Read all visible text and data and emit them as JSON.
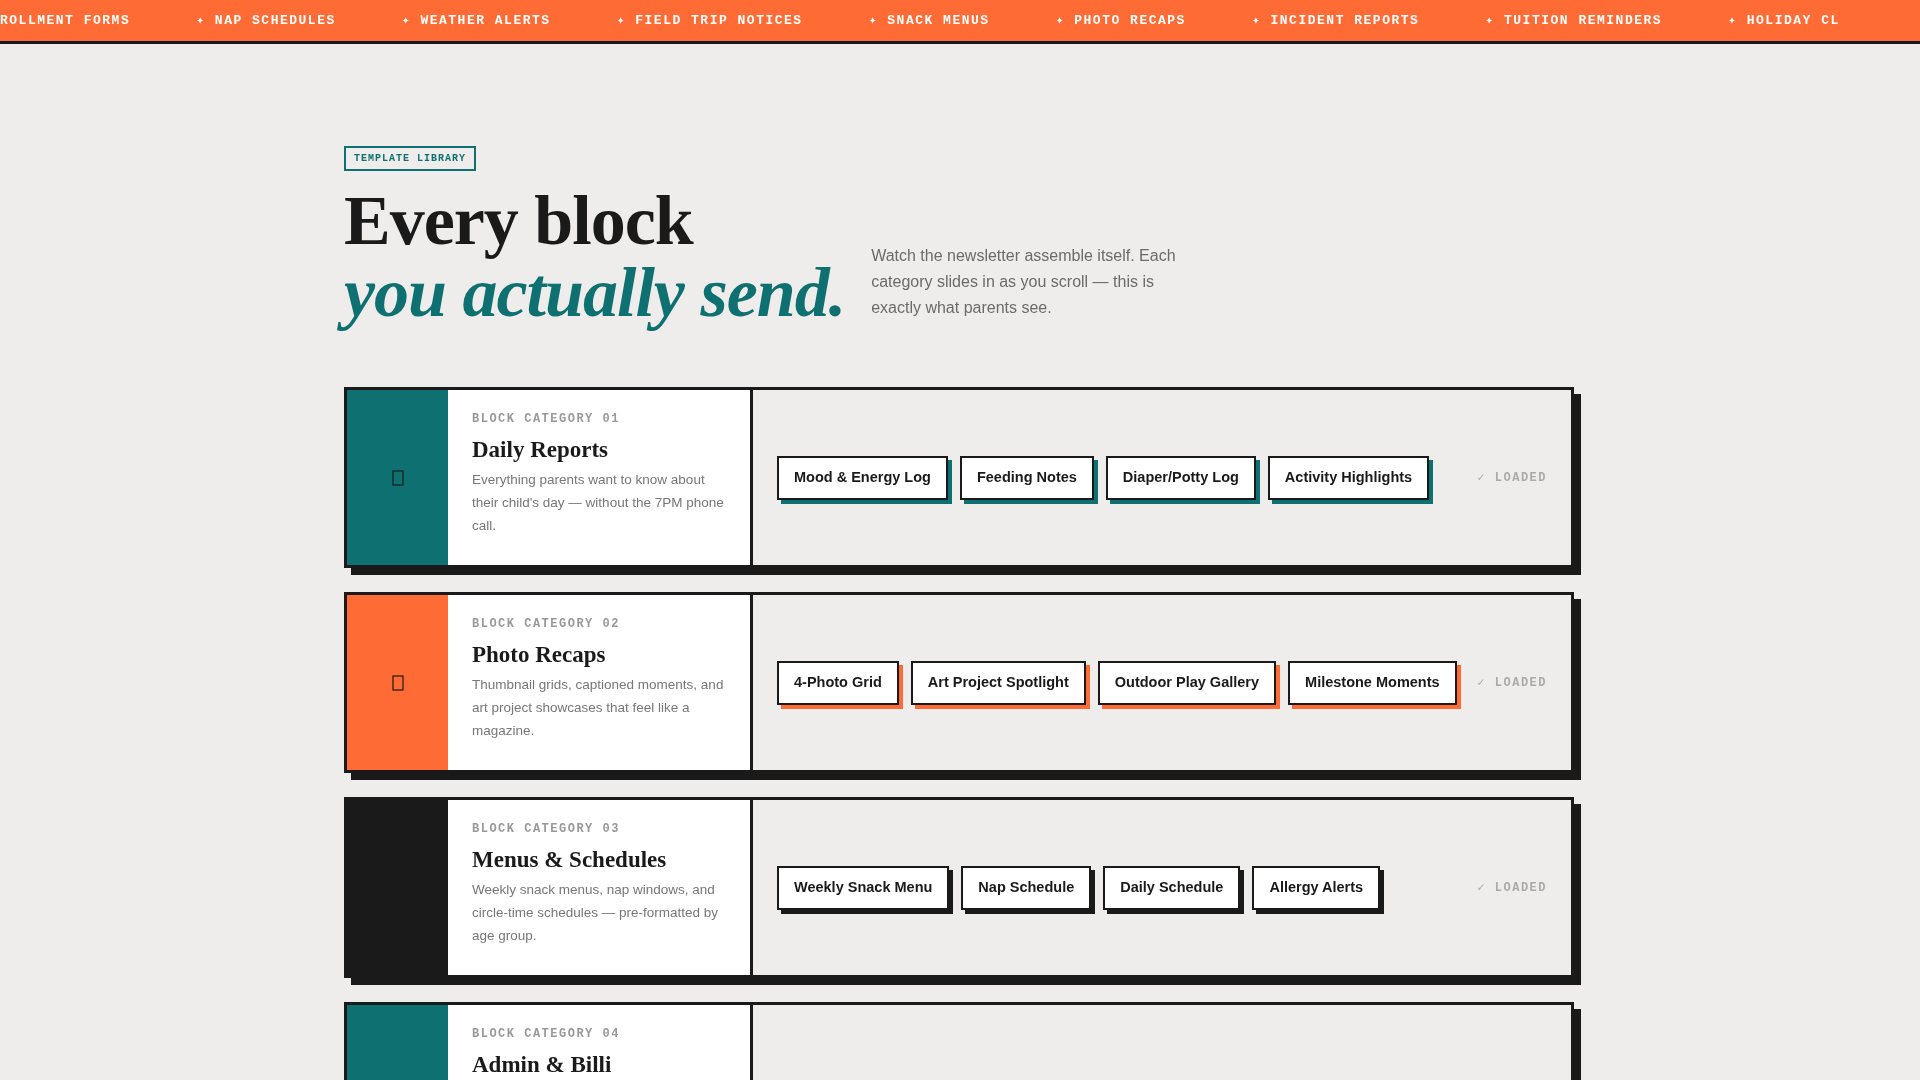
{
  "ticker": [
    "ROLLMENT FORMS",
    "✦ NAP SCHEDULES",
    "✦ WEATHER ALERTS",
    "✦ FIELD TRIP NOTICES",
    "✦ SNACK MENUS",
    "✦ PHOTO RECAPS",
    "✦ INCIDENT REPORTS",
    "✦ TUITION REMINDERS",
    "✦ HOLIDAY CL"
  ],
  "badge": "TEMPLATE LIBRARY",
  "headline": {
    "line1": "Every block",
    "line2": "you actually send."
  },
  "intro": "Watch the newsletter assemble itself. Each category slides in as you scroll — this is exactly what parents see.",
  "categories": [
    {
      "label": "BLOCK CATEGORY 01",
      "title": "Daily Reports",
      "description": "Everything parents want to know about their child's day — without the 7PM phone call.",
      "color": "#0e7070",
      "show_icon": true,
      "blocks": [
        "Mood & Energy Log",
        "Feeding Notes",
        "Diaper/Potty Log",
        "Activity Highlights"
      ],
      "status": "✓ LOADED"
    },
    {
      "label": "BLOCK CATEGORY 02",
      "title": "Photo Recaps",
      "description": "Thumbnail grids, captioned moments, and art project showcases that feel like a magazine.",
      "color": "#ff6b35",
      "show_icon": true,
      "blocks": [
        "4-Photo Grid",
        "Art Project Spotlight",
        "Outdoor Play Gallery",
        "Milestone Moments"
      ],
      "status": "✓ LOADED"
    },
    {
      "label": "BLOCK CATEGORY 03",
      "title": "Menus & Schedules",
      "description": "Weekly snack menus, nap windows, and circle-time schedules — pre-formatted by age group.",
      "color": "#1a1a1a",
      "blocks": [
        "Weekly Snack Menu",
        "Nap Schedule",
        "Daily Schedule",
        "Allergy Alerts"
      ],
      "status": "✓ LOADED"
    },
    {
      "label": "BLOCK CATEGORY 04",
      "title": "Admin & Billi",
      "color": "#0e7070"
    }
  ]
}
